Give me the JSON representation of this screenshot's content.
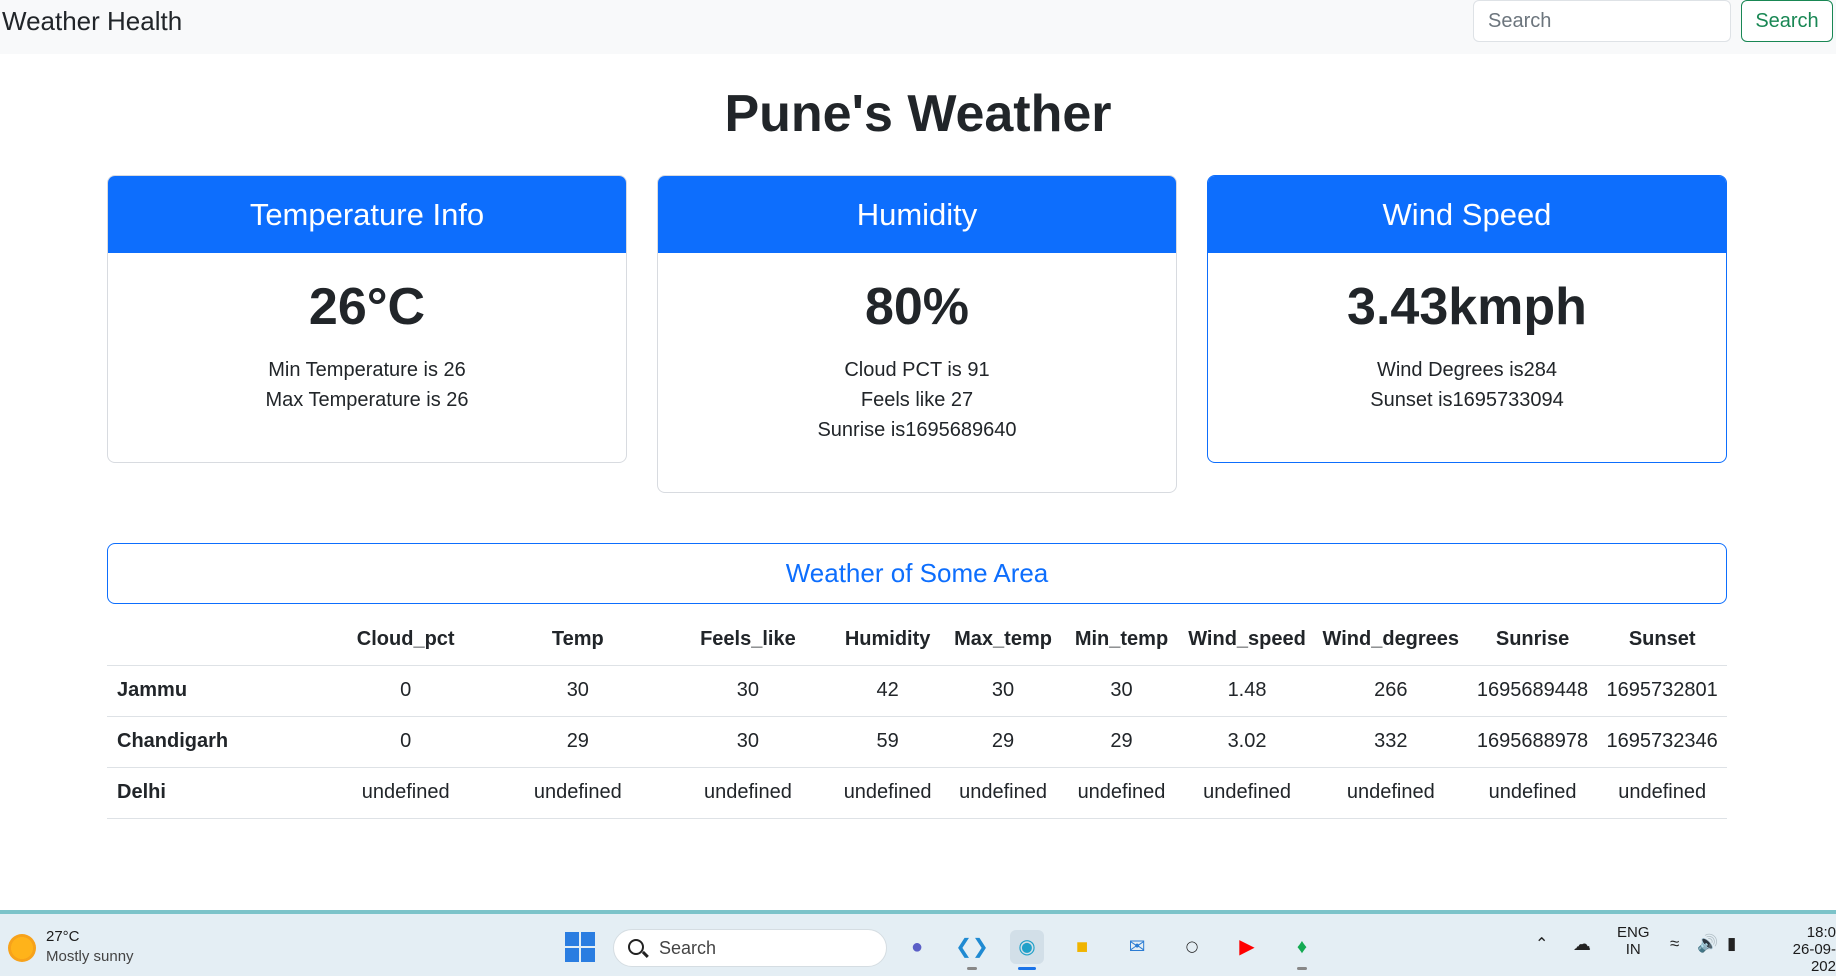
{
  "navbar": {
    "brand": "Weather Health",
    "search_placeholder": "Search",
    "search_button": "Search"
  },
  "page_title": "Pune's Weather",
  "cards": {
    "temperature": {
      "header": "Temperature Info",
      "value": "26°C",
      "lines": [
        "Min Temperature is 26",
        "Max Temperature is 26"
      ]
    },
    "humidity": {
      "header": "Humidity",
      "value": "80%",
      "lines": [
        "Cloud PCT is 91",
        "Feels like 27",
        "Sunrise is1695689640"
      ]
    },
    "wind": {
      "header": "Wind Speed",
      "value": "3.43kmph",
      "lines": [
        "Wind Degrees is284",
        "Sunset is1695733094"
      ]
    }
  },
  "area_section": {
    "title": "Weather of Some Area"
  },
  "table": {
    "headers": [
      "",
      "Cloud_pct",
      "Temp",
      "Feels_like",
      "Humidity",
      "Max_temp",
      "Min_temp",
      "Wind_speed",
      "Wind_degrees",
      "Sunrise",
      "Sunset"
    ],
    "rows": [
      {
        "city": "Jammu",
        "cells": [
          "0",
          "30",
          "30",
          "42",
          "30",
          "30",
          "1.48",
          "266",
          "1695689448",
          "1695732801"
        ]
      },
      {
        "city": "Chandigarh",
        "cells": [
          "0",
          "29",
          "30",
          "59",
          "29",
          "29",
          "3.02",
          "332",
          "1695688978",
          "1695732346"
        ]
      },
      {
        "city": "Delhi",
        "cells": [
          "undefined",
          "undefined",
          "undefined",
          "undefined",
          "undefined",
          "undefined",
          "undefined",
          "undefined",
          "undefined",
          "undefined"
        ]
      }
    ]
  },
  "taskbar": {
    "weather_temp": "27°C",
    "weather_desc": "Mostly sunny",
    "search_label": "Search",
    "language_top": "ENG",
    "language_bottom": "IN",
    "time": "18:0",
    "date": "26-09-202",
    "apps": [
      "teams-icon",
      "vscode-icon",
      "edge-icon",
      "file-explorer-icon",
      "mail-icon",
      "dell-icon",
      "youtube-icon",
      "mongodb-icon"
    ]
  },
  "colors": {
    "primary": "#0d6efd",
    "success": "#198754",
    "navbar_bg": "#f8f9fa"
  }
}
